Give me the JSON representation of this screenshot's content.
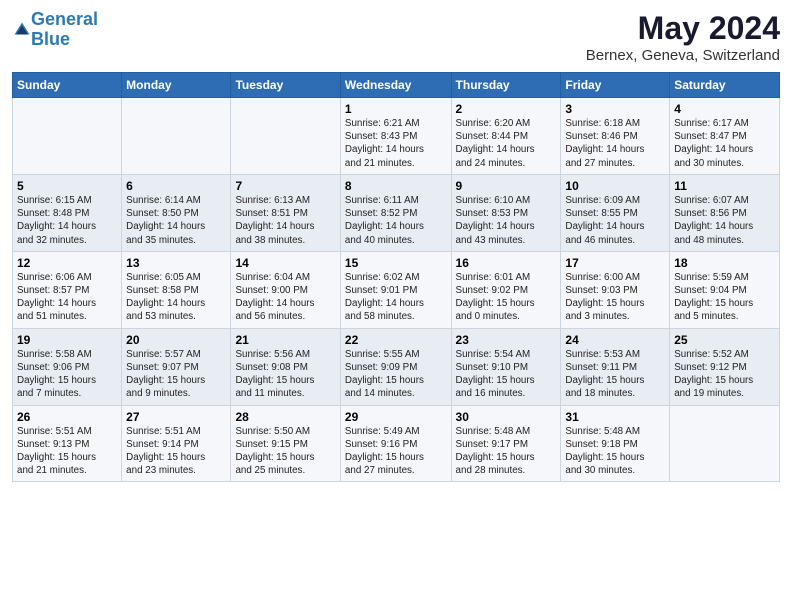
{
  "header": {
    "logo_line1": "General",
    "logo_line2": "Blue",
    "month": "May 2024",
    "location": "Bernex, Geneva, Switzerland"
  },
  "weekdays": [
    "Sunday",
    "Monday",
    "Tuesday",
    "Wednesday",
    "Thursday",
    "Friday",
    "Saturday"
  ],
  "weeks": [
    [
      {
        "day": "",
        "info": ""
      },
      {
        "day": "",
        "info": ""
      },
      {
        "day": "",
        "info": ""
      },
      {
        "day": "1",
        "info": "Sunrise: 6:21 AM\nSunset: 8:43 PM\nDaylight: 14 hours\nand 21 minutes."
      },
      {
        "day": "2",
        "info": "Sunrise: 6:20 AM\nSunset: 8:44 PM\nDaylight: 14 hours\nand 24 minutes."
      },
      {
        "day": "3",
        "info": "Sunrise: 6:18 AM\nSunset: 8:46 PM\nDaylight: 14 hours\nand 27 minutes."
      },
      {
        "day": "4",
        "info": "Sunrise: 6:17 AM\nSunset: 8:47 PM\nDaylight: 14 hours\nand 30 minutes."
      }
    ],
    [
      {
        "day": "5",
        "info": "Sunrise: 6:15 AM\nSunset: 8:48 PM\nDaylight: 14 hours\nand 32 minutes."
      },
      {
        "day": "6",
        "info": "Sunrise: 6:14 AM\nSunset: 8:50 PM\nDaylight: 14 hours\nand 35 minutes."
      },
      {
        "day": "7",
        "info": "Sunrise: 6:13 AM\nSunset: 8:51 PM\nDaylight: 14 hours\nand 38 minutes."
      },
      {
        "day": "8",
        "info": "Sunrise: 6:11 AM\nSunset: 8:52 PM\nDaylight: 14 hours\nand 40 minutes."
      },
      {
        "day": "9",
        "info": "Sunrise: 6:10 AM\nSunset: 8:53 PM\nDaylight: 14 hours\nand 43 minutes."
      },
      {
        "day": "10",
        "info": "Sunrise: 6:09 AM\nSunset: 8:55 PM\nDaylight: 14 hours\nand 46 minutes."
      },
      {
        "day": "11",
        "info": "Sunrise: 6:07 AM\nSunset: 8:56 PM\nDaylight: 14 hours\nand 48 minutes."
      }
    ],
    [
      {
        "day": "12",
        "info": "Sunrise: 6:06 AM\nSunset: 8:57 PM\nDaylight: 14 hours\nand 51 minutes."
      },
      {
        "day": "13",
        "info": "Sunrise: 6:05 AM\nSunset: 8:58 PM\nDaylight: 14 hours\nand 53 minutes."
      },
      {
        "day": "14",
        "info": "Sunrise: 6:04 AM\nSunset: 9:00 PM\nDaylight: 14 hours\nand 56 minutes."
      },
      {
        "day": "15",
        "info": "Sunrise: 6:02 AM\nSunset: 9:01 PM\nDaylight: 14 hours\nand 58 minutes."
      },
      {
        "day": "16",
        "info": "Sunrise: 6:01 AM\nSunset: 9:02 PM\nDaylight: 15 hours\nand 0 minutes."
      },
      {
        "day": "17",
        "info": "Sunrise: 6:00 AM\nSunset: 9:03 PM\nDaylight: 15 hours\nand 3 minutes."
      },
      {
        "day": "18",
        "info": "Sunrise: 5:59 AM\nSunset: 9:04 PM\nDaylight: 15 hours\nand 5 minutes."
      }
    ],
    [
      {
        "day": "19",
        "info": "Sunrise: 5:58 AM\nSunset: 9:06 PM\nDaylight: 15 hours\nand 7 minutes."
      },
      {
        "day": "20",
        "info": "Sunrise: 5:57 AM\nSunset: 9:07 PM\nDaylight: 15 hours\nand 9 minutes."
      },
      {
        "day": "21",
        "info": "Sunrise: 5:56 AM\nSunset: 9:08 PM\nDaylight: 15 hours\nand 11 minutes."
      },
      {
        "day": "22",
        "info": "Sunrise: 5:55 AM\nSunset: 9:09 PM\nDaylight: 15 hours\nand 14 minutes."
      },
      {
        "day": "23",
        "info": "Sunrise: 5:54 AM\nSunset: 9:10 PM\nDaylight: 15 hours\nand 16 minutes."
      },
      {
        "day": "24",
        "info": "Sunrise: 5:53 AM\nSunset: 9:11 PM\nDaylight: 15 hours\nand 18 minutes."
      },
      {
        "day": "25",
        "info": "Sunrise: 5:52 AM\nSunset: 9:12 PM\nDaylight: 15 hours\nand 19 minutes."
      }
    ],
    [
      {
        "day": "26",
        "info": "Sunrise: 5:51 AM\nSunset: 9:13 PM\nDaylight: 15 hours\nand 21 minutes."
      },
      {
        "day": "27",
        "info": "Sunrise: 5:51 AM\nSunset: 9:14 PM\nDaylight: 15 hours\nand 23 minutes."
      },
      {
        "day": "28",
        "info": "Sunrise: 5:50 AM\nSunset: 9:15 PM\nDaylight: 15 hours\nand 25 minutes."
      },
      {
        "day": "29",
        "info": "Sunrise: 5:49 AM\nSunset: 9:16 PM\nDaylight: 15 hours\nand 27 minutes."
      },
      {
        "day": "30",
        "info": "Sunrise: 5:48 AM\nSunset: 9:17 PM\nDaylight: 15 hours\nand 28 minutes."
      },
      {
        "day": "31",
        "info": "Sunrise: 5:48 AM\nSunset: 9:18 PM\nDaylight: 15 hours\nand 30 minutes."
      },
      {
        "day": "",
        "info": ""
      }
    ]
  ]
}
